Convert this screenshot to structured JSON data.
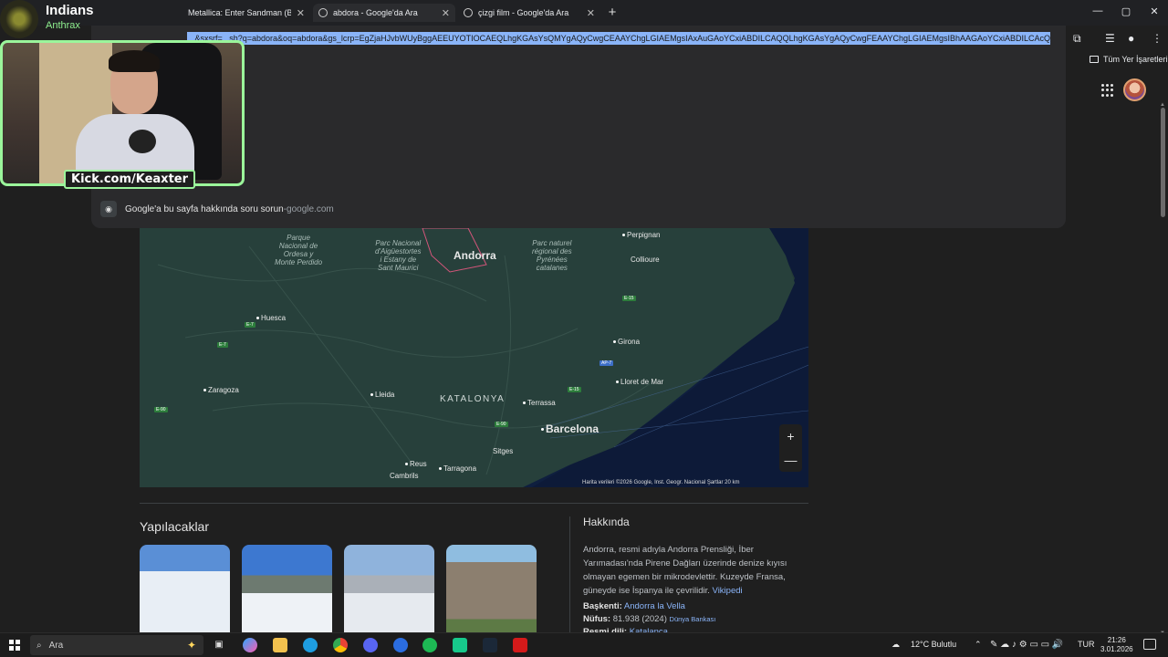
{
  "tabs": [
    {
      "title": "Metallica: Enter Sandman (Black...",
      "active": false
    },
    {
      "title": "abdora - Google'da Ara",
      "active": true
    },
    {
      "title": "çizgi film - Google'da Ara",
      "active": false
    }
  ],
  "new_tab_symbol": "+",
  "window_controls": {
    "minimize": "—",
    "maximize": "▢",
    "close": "✕"
  },
  "omnibox": {
    "url": "...&sxsrf=...sh?q=abdora&oq=abdora&gs_lcrp=EgZjaHJvbWUyBggAEEUYOTIOCAEQLhgKGAsYsQMYgAQyCwgCEAAYChgLGIAEMgsIAxAuGAoYCxiABDILCAQQLhgKGAsYgAQyCwgFEAAYChgLGIAEMgsIBhAAGAoYCxiABDILCAcQABgKGAsYgAQy",
    "suggestion_text": "Google'a bu sayfa hakkında soru sorun",
    "suggestion_domain": "google.com",
    "suggestion_separator": " - "
  },
  "bookmarks_label": "Tüm Yer İşaretleri",
  "webcam": {
    "title": "Indians",
    "subtitle": "Anthrax",
    "kick_label": "Kick.com/Keaxter"
  },
  "map": {
    "labels": {
      "andorra": "Andorra",
      "perpignan": "Perpignan",
      "collioure": "Collioure",
      "huesca": "Huesca",
      "girona": "Girona",
      "lloret": "Lloret de Mar",
      "zaragoza": "Zaragoza",
      "lleida": "Lleida",
      "katalonya": "KATALONYA",
      "terrassa": "Terrassa",
      "barcelona": "Barcelona",
      "sitges": "Sitges",
      "reus": "Reus",
      "tarragona": "Tarragona",
      "cambrils": "Cambrils",
      "park1": "Parque\nNacional de\nOrdesa y\nMonte Perdido",
      "park2": "Parc Nacional\nd'Aigüestortes\ni Estany de\nSant Maurici",
      "park3": "Parc naturel\nrégional des\nPyrénées\ncatalanes"
    },
    "roads": [
      "E-7",
      "E-7",
      "E-90",
      "E-90",
      "E-15",
      "AP-7",
      "E-15"
    ],
    "credit": "Harita verileri ©2026 Google, Inst. Geogr. Nacional   Şartlar   20 km",
    "zoom_in": "+",
    "zoom_out": "—"
  },
  "todo": {
    "title": "Yapılacaklar"
  },
  "about": {
    "title": "Hakkında",
    "description": "Andorra, resmi adıyla Andorra Prensliği, İber Yarımadası'nda Pirene Dağları üzerinde denize kıyısı olmayan egemen bir mikrodevlettir. Kuzeyde Fransa, güneyde ise İspanya ile çevrilidir.",
    "source_link": "Vikipedi",
    "capital_label": "Başkenti:",
    "capital_value": "Andorra la Vella",
    "population_label": "Nüfus:",
    "population_value": "81.938 (2024)",
    "population_source": "Dünya Bankası",
    "language_label": "Resmi dili:",
    "language_value": "Katalanca"
  },
  "taskbar": {
    "search_placeholder": "Ara",
    "weather": "12°C  Bulutlu",
    "lang": "TUR",
    "time": "21:26",
    "date": "3.01.2026"
  }
}
